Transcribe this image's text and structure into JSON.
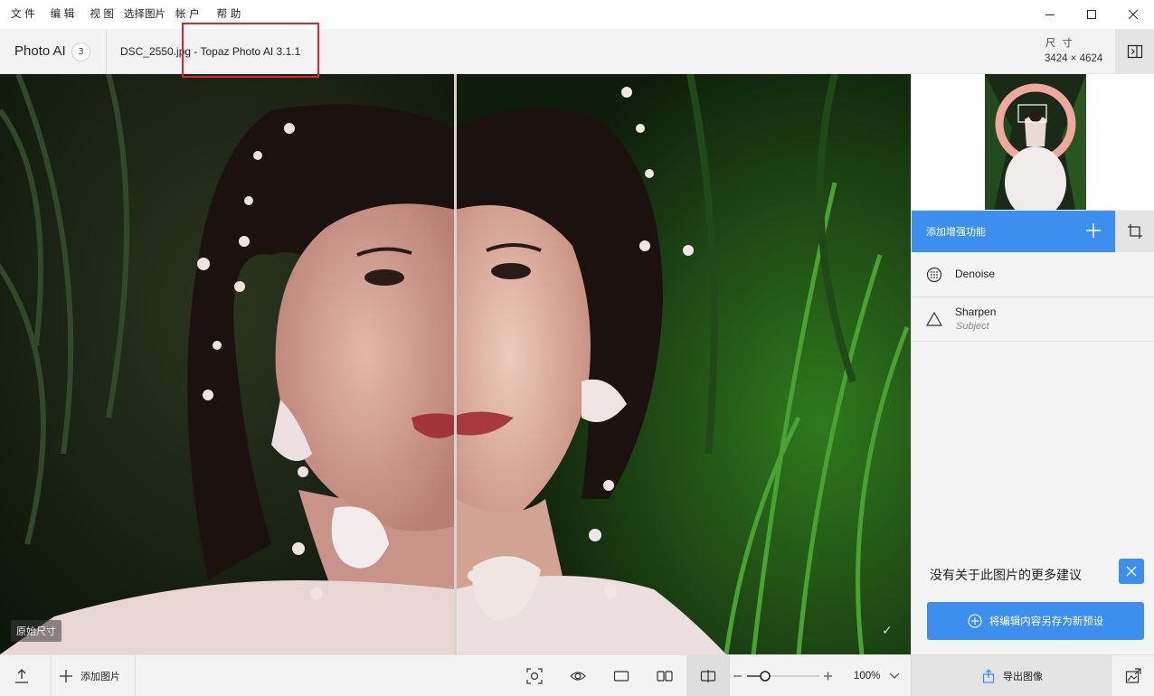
{
  "menubar": {
    "file": "文 件",
    "edit": "编 辑",
    "view": "视 图",
    "select_image": "选择图片",
    "account": "帐 户",
    "help": "帮 助"
  },
  "titlebar": {
    "app_name": "Photo AI",
    "image_count": "3",
    "document_title": "DSC_2550.jpg - Topaz Photo AI 3.1.1",
    "size_label": "尺 寸",
    "size_value": "3424 × 4624"
  },
  "canvas": {
    "original_size_tag": "原始尺寸",
    "check": "✓"
  },
  "sidebar": {
    "add_enhancement": "添加增强功能",
    "enhancements": [
      {
        "name": "Denoise",
        "icon": "denoise-icon"
      },
      {
        "name": "Sharpen",
        "sub": "Subject",
        "icon": "sharpen-icon"
      }
    ],
    "no_more_suggestions": "没有关于此图片的更多建议",
    "save_preset": "将编辑内容另存为新预设"
  },
  "bottombar": {
    "add_photo": "添加图片",
    "zoom": "100%",
    "zoom_level": 0.25,
    "export": "导出图像"
  },
  "colors": {
    "accent": "#3d8fef",
    "highlight": "#e0262b"
  }
}
